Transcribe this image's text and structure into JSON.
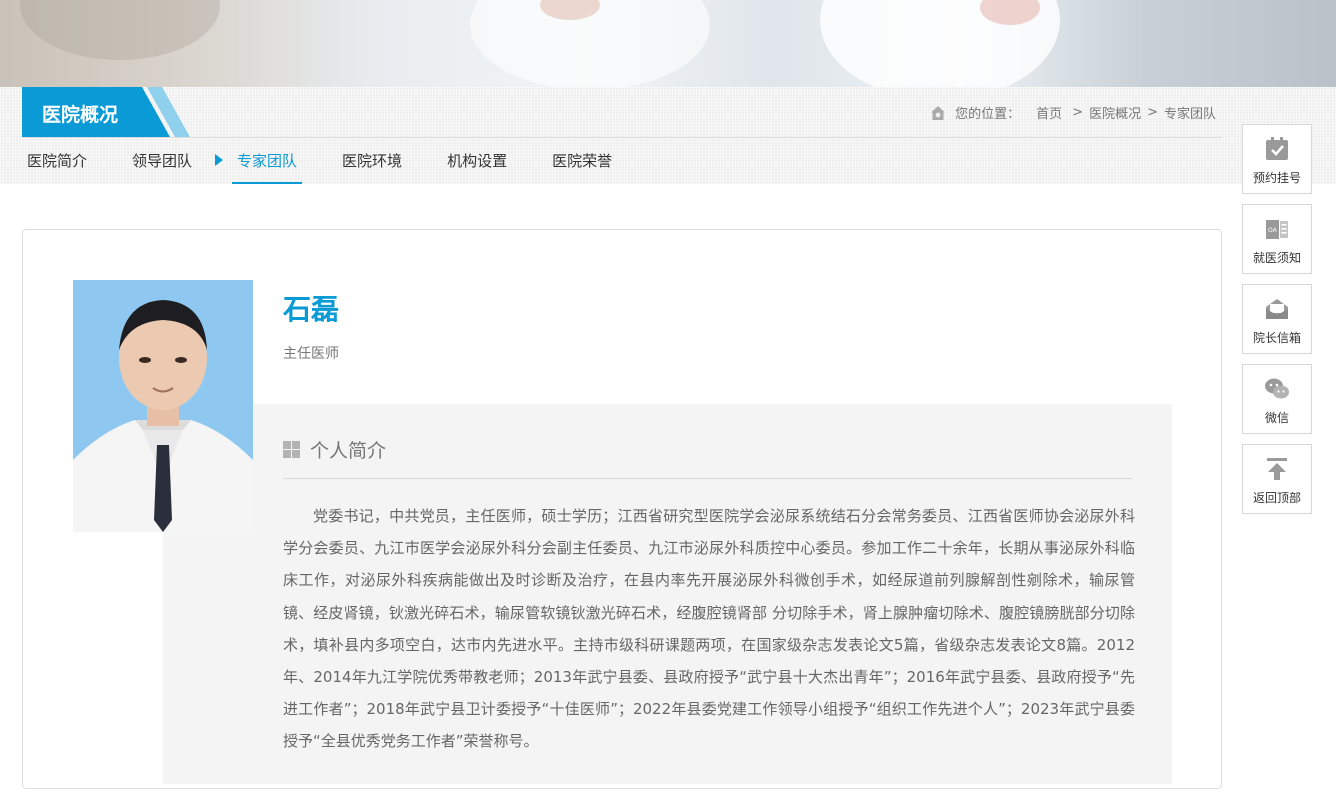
{
  "section": {
    "title": "医院概况"
  },
  "breadcrumb": {
    "label": "您的位置：",
    "items": [
      "首页",
      "医院概况",
      "专家团队"
    ],
    "sep": ">"
  },
  "nav": {
    "items": [
      "医院简介",
      "领导团队",
      "专家团队",
      "医院环境",
      "机构设置",
      "医院荣誉"
    ],
    "active": 2
  },
  "doctor": {
    "name": "石磊",
    "title": "主任医师",
    "intro_heading": "个人简介",
    "intro": "党委书记，中共党员，主任医师，硕士学历；江西省研究型医院学会泌尿系统结石分会常务委员、江西省医师协会泌尿外科学分会委员、九江市医学会泌尿外科分会副主任委员、九江市泌尿外科质控中心委员。参加工作二十余年，长期从事泌尿外科临床工作，对泌尿外科疾病能做出及时诊断及治疗，在县内率先开展泌尿外科微创手术，如经尿道前列腺解剖性剜除术，输尿管镜、经皮肾镜，钬激光碎石术，输尿管软镜钬激光碎石术，经腹腔镜肾部 分切除手术，肾上腺肿瘤切除术、腹腔镜膀胱部分切除术，填补县内多项空白，达市内先进水平。主持市级科研课题两项，在国家级杂志发表论文5篇，省级杂志发表论文8篇。2012年、2014年九江学院优秀带教老师；2013年武宁县委、县政府授予“武宁县十大杰出青年”；2016年武宁县委、县政府授予“先进工作者”；2018年武宁县卫计委授予“十佳医师”；2022年县委党建工作领导小组授予“组织工作先进个人”；2023年武宁县委授予“全县优秀党务工作者”荣誉称号。"
  },
  "side": [
    {
      "label": "预约挂号",
      "icon": "calendar-check-icon"
    },
    {
      "label": "就医须知",
      "icon": "notice-book-icon"
    },
    {
      "label": "院长信箱",
      "icon": "mailbox-icon"
    },
    {
      "label": "微信",
      "icon": "wechat-icon"
    },
    {
      "label": "返回顶部",
      "icon": "back-to-top-icon"
    }
  ],
  "colors": {
    "accent": "#0a9ad6",
    "photo_bg": "#8ec8f0"
  }
}
